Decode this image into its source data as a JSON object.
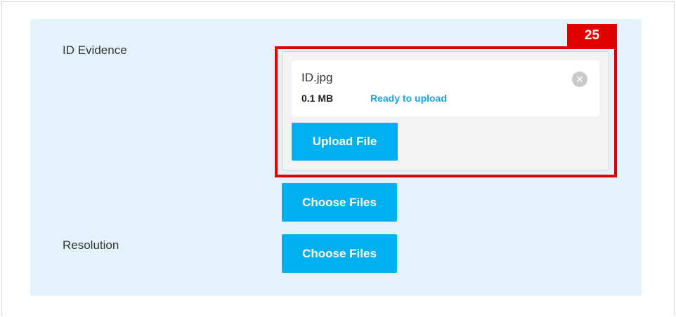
{
  "form": {
    "id_evidence_label": "ID Evidence",
    "resolution_label": "Resolution"
  },
  "uploader": {
    "file_name": "ID.jpg",
    "file_size": "0.1 MB",
    "status": "Ready to upload",
    "remove_icon": "close-icon",
    "upload_button": "Upload File"
  },
  "buttons": {
    "choose_files_id": "Choose Files",
    "choose_files_resolution": "Choose Files"
  },
  "annotation": {
    "badge": "25",
    "color": "#e10000"
  },
  "colors": {
    "accent": "#00aff0",
    "status": "#1aa3e8",
    "panel_background": "#e4f3fb"
  }
}
